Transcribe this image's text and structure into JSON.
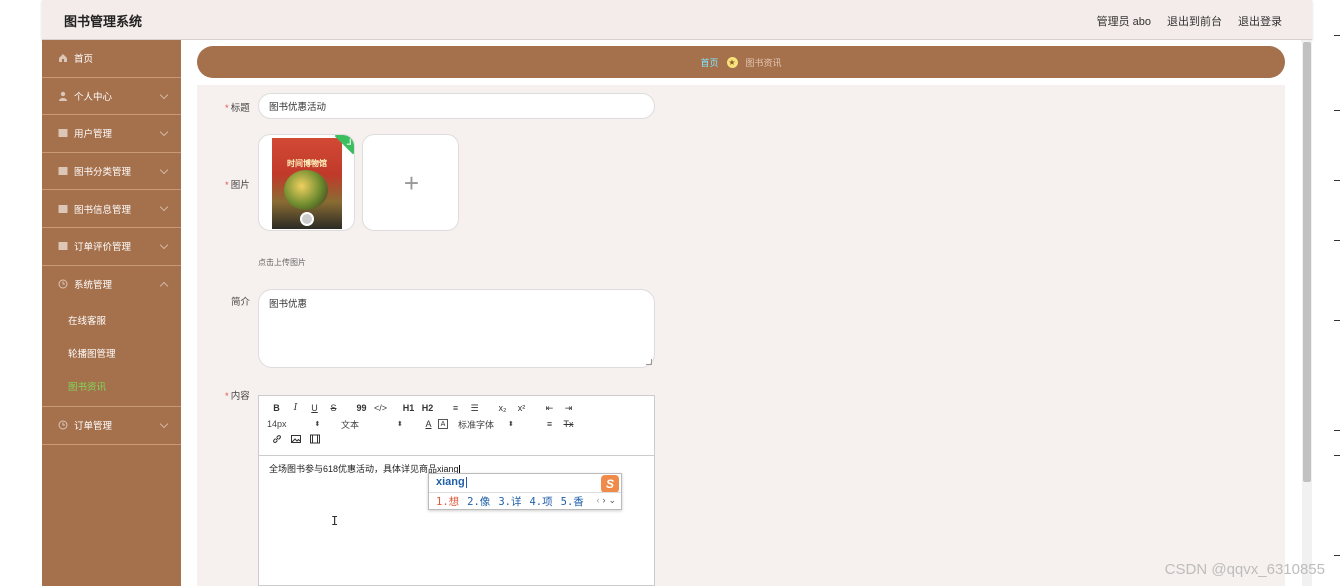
{
  "app": {
    "title": "图书管理系统"
  },
  "header": {
    "user": "管理员 abo",
    "to_front": "退出到前台",
    "logout": "退出登录"
  },
  "sidebar": {
    "items": [
      {
        "label": "首页",
        "icon": "home-icon"
      },
      {
        "label": "个人中心",
        "icon": "user-icon"
      },
      {
        "label": "用户管理",
        "icon": "grid-icon"
      },
      {
        "label": "图书分类管理",
        "icon": "grid-icon"
      },
      {
        "label": "图书信息管理",
        "icon": "grid-icon"
      },
      {
        "label": "订单评价管理",
        "icon": "grid-icon"
      },
      {
        "label": "系统管理",
        "icon": "clock-icon"
      },
      {
        "label": "订单管理",
        "icon": "clock-icon"
      }
    ],
    "system_sub": [
      {
        "label": "在线客服"
      },
      {
        "label": "轮播图管理"
      },
      {
        "label": "图书资讯"
      }
    ]
  },
  "breadcrumb": {
    "home": "首页",
    "current": "图书资讯"
  },
  "form": {
    "title_label": "标题",
    "title_value": "图书优惠活动",
    "image_label": "图片",
    "book_cover_title": "时间博物馆",
    "upload_hint": "点击上传图片",
    "intro_label": "简介",
    "intro_value": "图书优惠",
    "content_label": "内容",
    "content_text": "全场图书参与618优惠活动，具体详见商品xiang"
  },
  "editor": {
    "toolbar_row1": [
      "B",
      "I",
      "U",
      "S",
      "99",
      "</>",
      "H1",
      "H2",
      "≡",
      "☰",
      "x₂",
      "x²",
      "⇤",
      "⇥"
    ],
    "font_size": "14px",
    "text_type": "文本",
    "font_color": "A",
    "bg_color": "A",
    "font_family": "标准字体",
    "align": "≡",
    "clear": "Tx"
  },
  "ime": {
    "pinyin": "xiang",
    "candidates": [
      "1.想",
      "2.像",
      "3.详",
      "4.项",
      "5.香"
    ],
    "logo": "S"
  },
  "watermark": "CSDN @qqvx_6310855"
}
